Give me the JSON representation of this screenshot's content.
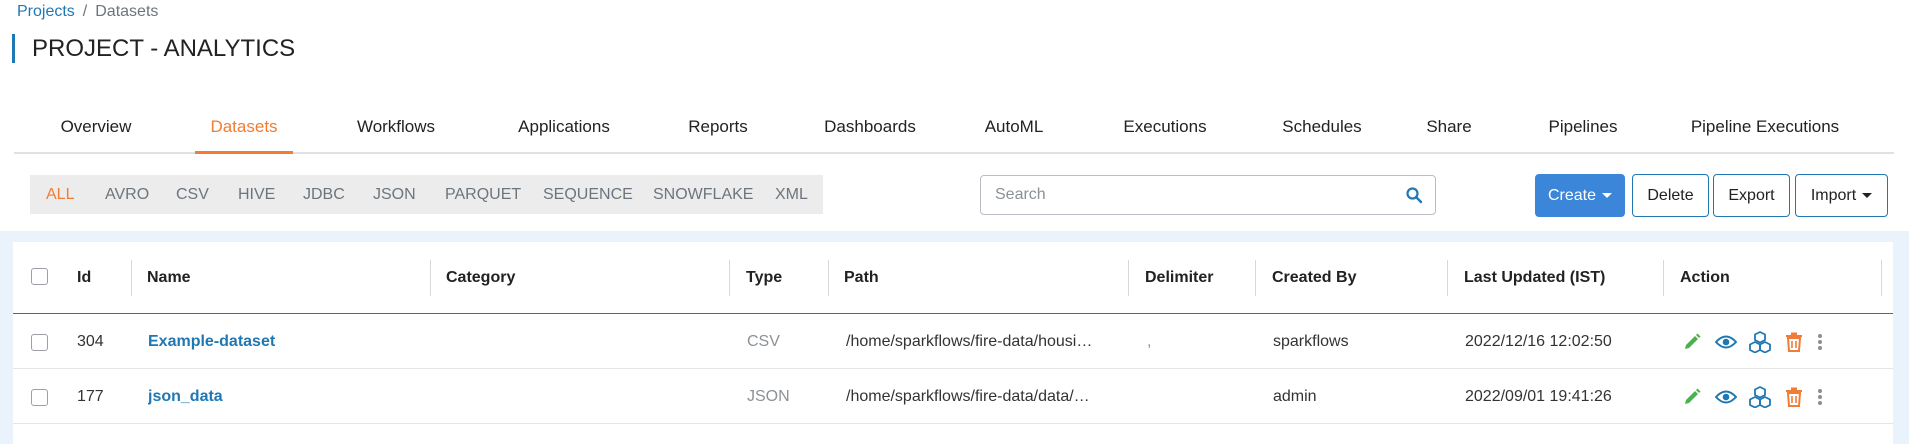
{
  "breadcrumb": {
    "projects": "Projects",
    "separator": "/",
    "current": "Datasets"
  },
  "page_title": "PROJECT - ANALYTICS",
  "tabs": [
    {
      "label": "Overview",
      "active": false
    },
    {
      "label": "Datasets",
      "active": true
    },
    {
      "label": "Workflows",
      "active": false
    },
    {
      "label": "Applications",
      "active": false
    },
    {
      "label": "Reports",
      "active": false
    },
    {
      "label": "Dashboards",
      "active": false
    },
    {
      "label": "AutoML",
      "active": false
    },
    {
      "label": "Executions",
      "active": false
    },
    {
      "label": "Schedules",
      "active": false
    },
    {
      "label": "Share",
      "active": false
    },
    {
      "label": "Pipelines",
      "active": false
    },
    {
      "label": "Pipeline Executions",
      "active": false
    }
  ],
  "type_filters": [
    {
      "label": "ALL",
      "active": true
    },
    {
      "label": "AVRO"
    },
    {
      "label": "CSV"
    },
    {
      "label": "HIVE"
    },
    {
      "label": "JDBC"
    },
    {
      "label": "JSON"
    },
    {
      "label": "PARQUET"
    },
    {
      "label": "SEQUENCE"
    },
    {
      "label": "SNOWFLAKE"
    },
    {
      "label": "XML"
    }
  ],
  "search": {
    "placeholder": "Search",
    "value": "",
    "icon": "search-icon"
  },
  "buttons": {
    "create": "Create",
    "delete": "Delete",
    "export": "Export",
    "import": "Import"
  },
  "table": {
    "columns": [
      "Id",
      "Name",
      "Category",
      "Type",
      "Path",
      "Delimiter",
      "Created By",
      "Last Updated (IST)",
      "Action"
    ],
    "rows": [
      {
        "id": "304",
        "name": "Example-dataset",
        "category": "",
        "type": "CSV",
        "path": "/home/sparkflows/fire-data/housi…",
        "delimiter": ",",
        "created_by": "sparkflows",
        "last_updated": "2022/12/16 12:02:50"
      },
      {
        "id": "177",
        "name": "json_data",
        "category": "",
        "type": "JSON",
        "path": "/home/sparkflows/fire-data/data/…",
        "delimiter": "",
        "created_by": "admin",
        "last_updated": "2022/09/01 19:41:26"
      }
    ],
    "action_icons": [
      "edit-icon",
      "view-icon",
      "cubes-icon",
      "delete-icon",
      "more-icon"
    ]
  },
  "colors": {
    "accent": "#f07c35",
    "link": "#1f78b4",
    "primary_button": "#3b86d9",
    "edit": "#4caf50",
    "view": "#1f78b4",
    "cubes": "#1f78b4",
    "delete": "#f07c35",
    "more": "#8a8f94"
  }
}
